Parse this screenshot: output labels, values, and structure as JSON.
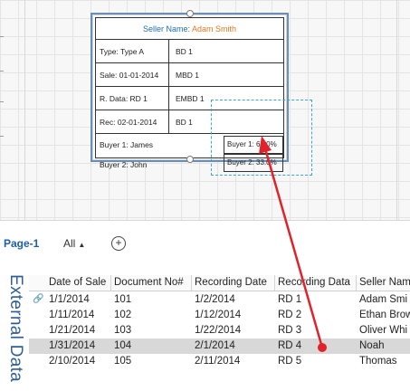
{
  "shape": {
    "title_prefix": "Seller Name: ",
    "seller_name": "Adam Smith",
    "rows": [
      {
        "left": "Type: Type A",
        "right": "BD 1"
      },
      {
        "left": "Sale: 01-01-2014",
        "right": "MBD 1"
      },
      {
        "left": "R. Data: RD 1",
        "right": "EMBD 1"
      },
      {
        "left": "Rec: 02-01-2014",
        "right": "BD 1"
      }
    ],
    "buyers": [
      {
        "name": "Buyer 1: James",
        "share": "Buyer 1: 67.0%"
      },
      {
        "name": "Buyer 2: John",
        "share": "Buyer 2: 33.0%"
      }
    ]
  },
  "tabs": {
    "page": "Page-1",
    "all": "All",
    "add_icon": "plus-circle-icon"
  },
  "external_data": {
    "label": "External Data",
    "columns": [
      "Date of Sale",
      "Document No#",
      "Recording Date",
      "Recording Data",
      "Seller Nam"
    ],
    "rows": [
      [
        "1/1/2014",
        "101",
        "1/2/2014",
        "RD 1",
        "Adam Smi"
      ],
      [
        "1/11/2014",
        "102",
        "1/12/2014",
        "RD 2",
        "Ethan Brow"
      ],
      [
        "1/21/2014",
        "103",
        "1/22/2014",
        "RD 3",
        "Oliver Whi"
      ],
      [
        "1/31/2014",
        "104",
        "2/1/2014",
        "RD 4",
        "Noah"
      ],
      [
        "2/10/2014",
        "105",
        "2/11/2014",
        "RD 5",
        "Thomas"
      ]
    ],
    "selected_row": 3,
    "linked_row": 0
  },
  "colors": {
    "arrow": "#e0232b",
    "title": "#1f6fb4",
    "seller": "#e07a1f",
    "selection": "#39a5d8"
  }
}
